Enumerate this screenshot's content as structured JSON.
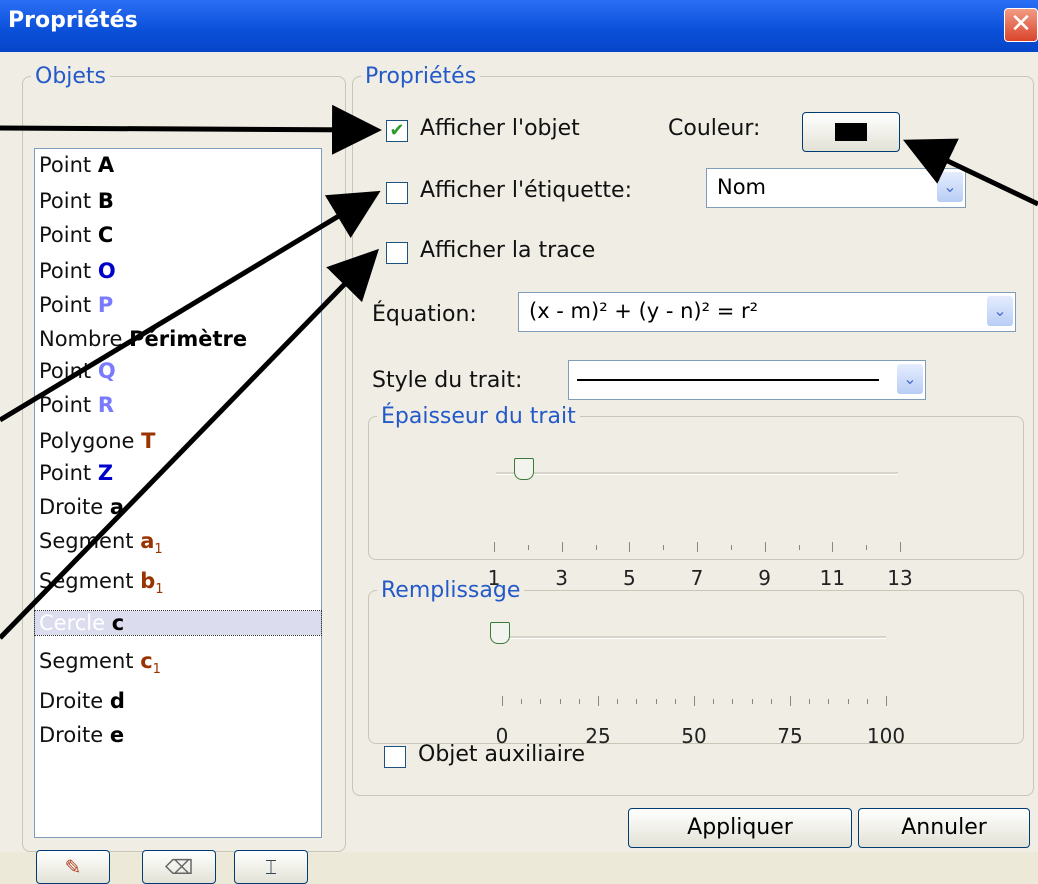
{
  "window": {
    "title": "Propriétés"
  },
  "objects_panel": {
    "legend": "Objets",
    "items": [
      {
        "prefix": "Point",
        "name": "A",
        "color": "#000000"
      },
      {
        "prefix": "Point",
        "name": "B",
        "color": "#000000"
      },
      {
        "prefix": "Point",
        "name": "C",
        "color": "#000000"
      },
      {
        "prefix": "Point",
        "name": "O",
        "color": "#0000cc"
      },
      {
        "prefix": "Point",
        "name": "P",
        "color": "#7a7aff"
      },
      {
        "prefix": "Nombre",
        "name": "Périmètre",
        "color": "#000000"
      },
      {
        "prefix": "Point",
        "name": "Q",
        "color": "#7a7aff"
      },
      {
        "prefix": "Point",
        "name": "R",
        "color": "#7a7aff"
      },
      {
        "prefix": "Polygone",
        "name": "T",
        "color": "#993300"
      },
      {
        "prefix": "Point",
        "name": "Z",
        "color": "#0000cc"
      },
      {
        "prefix": "Droite",
        "name": "a",
        "color": "#000000"
      },
      {
        "prefix": "Segment",
        "name": "a",
        "sub": "1",
        "color": "#993300"
      },
      {
        "prefix": "Segment",
        "name": "b",
        "sub": "1",
        "color": "#993300"
      },
      {
        "prefix": "Cercle",
        "name": "c",
        "color": "#000000",
        "selected": true
      },
      {
        "prefix": "Segment",
        "name": "c",
        "sub": "1",
        "color": "#993300"
      },
      {
        "prefix": "Droite",
        "name": "d",
        "color": "#000000"
      },
      {
        "prefix": "Droite",
        "name": "e",
        "color": "#000000"
      }
    ]
  },
  "properties_panel": {
    "legend": "Propriétés",
    "show_object_label": "Afficher l'objet",
    "show_object_checked": true,
    "color_label": "Couleur:",
    "show_label_label": "Afficher l'étiquette:",
    "show_label_checked": false,
    "label_mode": "Nom",
    "show_trace_label": "Afficher la trace",
    "show_trace_checked": false,
    "equation_label": "Équation:",
    "equation_value": "(x - m)² + (y - n)² = r²",
    "line_style_label": "Style du trait:",
    "thickness_legend": "Épaisseur du trait",
    "thickness_ticks": [
      "1",
      "3",
      "5",
      "7",
      "9",
      "11",
      "13"
    ],
    "thickness_value": 2,
    "fill_legend": "Remplissage",
    "fill_ticks": [
      "0",
      "25",
      "50",
      "75",
      "100"
    ],
    "fill_value": 0,
    "auxiliary_label": "Objet auxiliaire",
    "auxiliary_checked": false
  },
  "buttons": {
    "apply": "Appliquer",
    "cancel": "Annuler"
  },
  "colors": {
    "title_bar": "#0a4fd8",
    "legend": "#2459c9",
    "object_color": "#000000"
  }
}
